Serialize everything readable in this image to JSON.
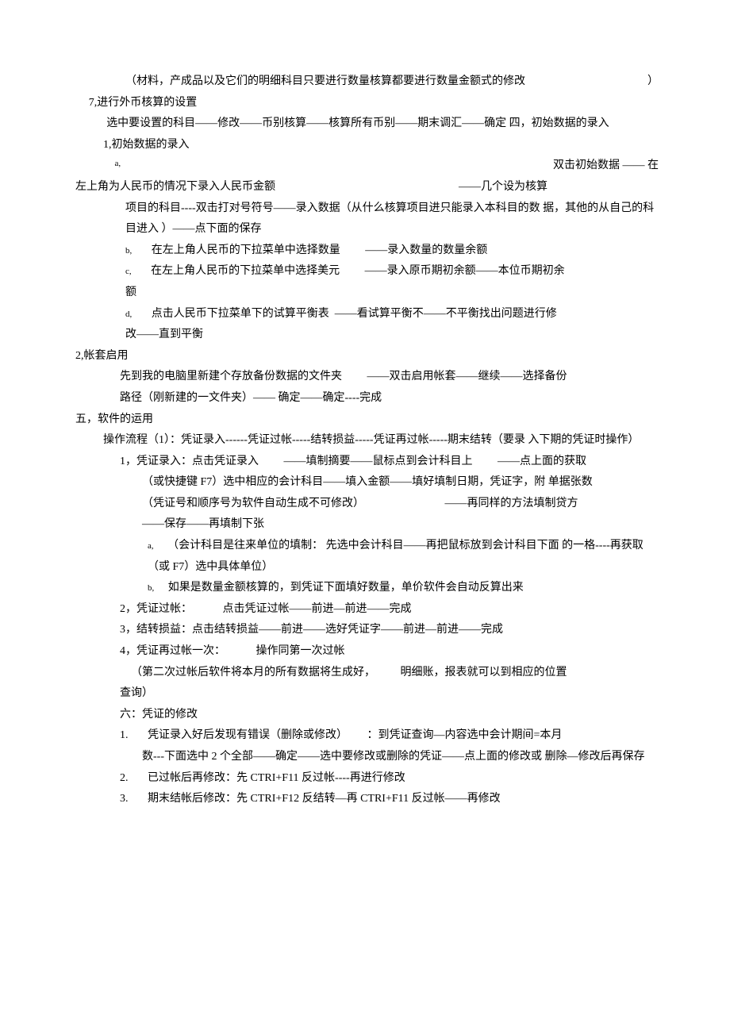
{
  "l1a": "（材料，产成品以及它们的明细科目只要进行数量核算都要进行数量金额式的修改",
  "l1b": "）",
  "l2": "7,进行外币核算的设置",
  "l3": "选中要设置的科目——修改——币别核算——核算所有币别——期末调汇——确定  四，初始数据的录入",
  "l4": "1,初始数据的录入",
  "l5a": "a,",
  "l5b": "双击初始数据  ——  在",
  "l6a": "左上角为人民币的情况下录入人民币金额",
  "l6b": "——几个设为核算",
  "l7": "项目的科目----双击打对号符号——录入数据（从什么核算项目进只能录入本科目的数  据，其他的从自己的科目进入 ）——点下面的保存",
  "l8a": "b,",
  "l8b": "在左上角人民币的下拉菜单中选择数量",
  "l8c": "——录入数量的数量余额",
  "l9a": "c,",
  "l9b": "在左上角人民币的下拉菜单中选择美元",
  "l9c": "——录入原币期初余额——本位币期初余",
  "l9d": "额",
  "l10a": "d,",
  "l10b": "点击人民币下拉菜单下的试算平衡表  ——看试算平衡不——不平衡找出问题进行修",
  "l10c": "改——直到平衡",
  "l11": "2,帐套启用",
  "l12a": "先到我的电脑里新建个存放备份数据的文件夹",
  "l12b": "——双击启用帐套——继续——选择备份",
  "l12c": "路径（刚新建的一文件夹）——  确定——确定----完成",
  "l13": "五，软件的运用",
  "l14": "操作流程（1）：凭证录入------凭证过帐-----结转损益-----凭证再过帐-----期末结转（要录  入下期的凭证时操作）",
  "l15a": "1，凭证录入：点击凭证录入",
  "l15b": "——填制摘要——鼠标点到会计科目上",
  "l15c": "——点上面的获取",
  "l16": "（或快捷键 F7）选中相应的会计科目——填入金额——填好填制日期，凭证字，附  单据张数",
  "l17a": "（凭证号和顺序号为软件自动生成不可修改）",
  "l17b": "——再同样的方法填制贷方",
  "l18": "——保存——再填制下张",
  "l19a": "a,",
  "l19b": "（会计科目是往来单位的填制：  先选中会计科目——再把鼠标放到会计科目下面  的一格----再获取（或 F7）选中具体单位）",
  "l20a": "b,",
  "l20b": "如果是数量金额核算的，到凭证下面填好数量，单价软件会自动反算出来",
  "l21a": "2，凭证过帐：",
  "l21b": "点击凭证过帐——前进—前进——完成",
  "l22": "3，结转损益：点击结转损益——前进——选好凭证字——前进—前进——完成",
  "l23a": "4，凭证再过帐一次：",
  "l23b": "操作同第一次过帐",
  "l24a": "（第二次过帐后软件将本月的所有数据将生成好，",
  "l24b": "明细账，报表就可以到相应的位置",
  "l24c": "查询）",
  "l25": "六：凭证的修改",
  "l26a": "1.",
  "l26b": "凭证录入好后发现有错误（删除或修改）",
  "l26c": "：到凭证查询—内容选中会计期间=本月",
  "l26d": "数---下面选中 2 个全部——确定——选中要修改或删除的凭证——点上面的修改或  删除—修改后再保存",
  "l27a": "2.",
  "l27b": "已过帐后再修改：先  CTRI+F11 反过帐----再进行修改",
  "l28a": "3.",
  "l28b": "期末结帐后修改：先  CTRI+F12 反结转—再 CTRI+F11 反过帐——再修改"
}
